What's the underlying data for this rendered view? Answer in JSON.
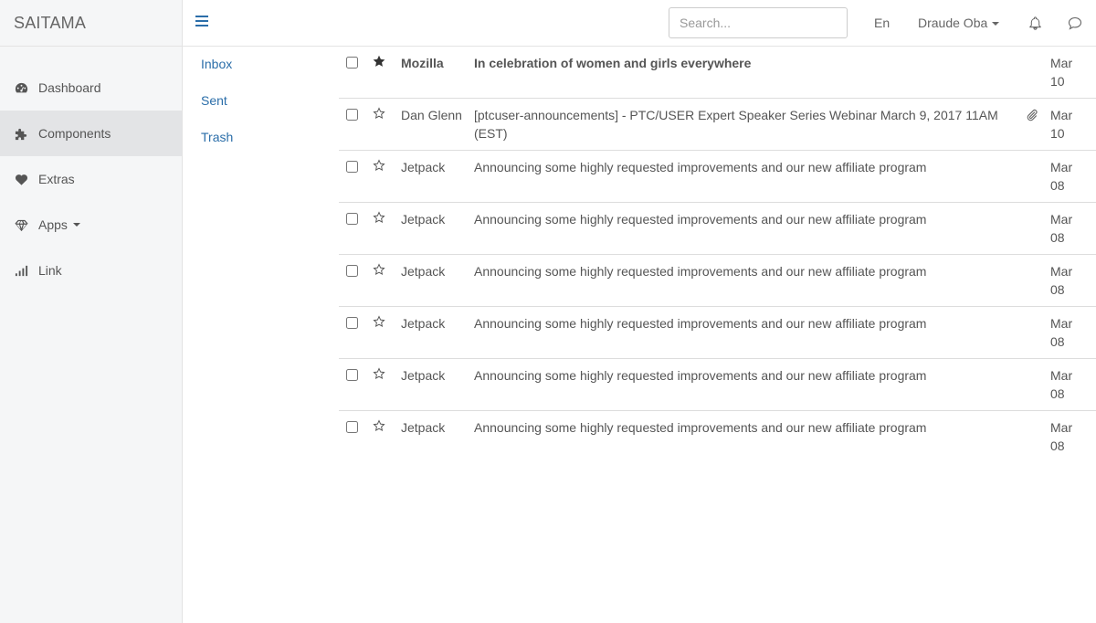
{
  "brand": "SAITAMA",
  "sidebar": {
    "items": [
      {
        "label": "Dashboard",
        "icon": "dashboard-icon"
      },
      {
        "label": "Components",
        "icon": "puzzle-icon"
      },
      {
        "label": "Extras",
        "icon": "heart-icon"
      },
      {
        "label": "Apps",
        "icon": "diamond-icon"
      },
      {
        "label": "Link",
        "icon": "signal-icon"
      }
    ],
    "active": "Components"
  },
  "topbar": {
    "search_placeholder": "Search...",
    "language": "En",
    "user_name": "Draude Oba"
  },
  "folders": [
    "Inbox",
    "Sent",
    "Trash"
  ],
  "emails": [
    {
      "from": "Mozilla",
      "subject": "In celebration of women and girls everywhere",
      "date": "Mar 10",
      "starred": true,
      "unread": true,
      "attachment": false
    },
    {
      "from": "Dan Glenn",
      "subject": "[ptcuser-announcements] - PTC/USER Expert Speaker Series Webinar March 9, 2017 11AM (EST)",
      "date": "Mar 10",
      "starred": false,
      "unread": false,
      "attachment": true
    },
    {
      "from": "Jetpack",
      "subject": "Announcing some highly requested improvements and our new affiliate program",
      "date": "Mar 08",
      "starred": false,
      "unread": false,
      "attachment": false
    },
    {
      "from": "Jetpack",
      "subject": "Announcing some highly requested improvements and our new affiliate program",
      "date": "Mar 08",
      "starred": false,
      "unread": false,
      "attachment": false
    },
    {
      "from": "Jetpack",
      "subject": "Announcing some highly requested improvements and our new affiliate program",
      "date": "Mar 08",
      "starred": false,
      "unread": false,
      "attachment": false
    },
    {
      "from": "Jetpack",
      "subject": "Announcing some highly requested improvements and our new affiliate program",
      "date": "Mar 08",
      "starred": false,
      "unread": false,
      "attachment": false
    },
    {
      "from": "Jetpack",
      "subject": "Announcing some highly requested improvements and our new affiliate program",
      "date": "Mar 08",
      "starred": false,
      "unread": false,
      "attachment": false
    },
    {
      "from": "Jetpack",
      "subject": "Announcing some highly requested improvements and our new affiliate program",
      "date": "Mar 08",
      "starred": false,
      "unread": false,
      "attachment": false
    }
  ],
  "colors": {
    "link": "#2b6ea9",
    "sidebar_bg": "#f5f6f7",
    "active_bg": "#e3e4e6"
  }
}
